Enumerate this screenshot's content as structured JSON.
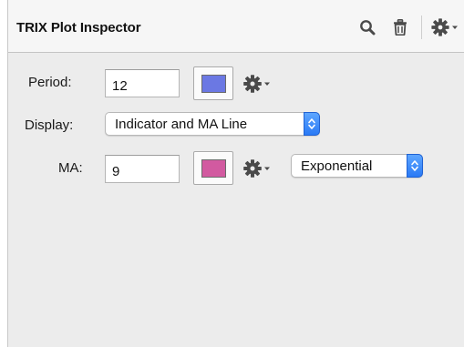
{
  "panel": {
    "title": "TRIX Plot Inspector",
    "toolbar": {
      "icons": [
        "search-icon",
        "trash-icon",
        "gear-menu-icon"
      ]
    }
  },
  "period": {
    "label": "Period:",
    "value": "12",
    "color": "#6b78e3"
  },
  "display": {
    "label": "Display:",
    "selected": "Indicator and MA Line"
  },
  "ma": {
    "label": "MA:",
    "value": "9",
    "color": "#d25aa0",
    "type_selected": "Exponential"
  },
  "colors": {
    "accent": "#2a7af5",
    "background": "#ececec"
  }
}
